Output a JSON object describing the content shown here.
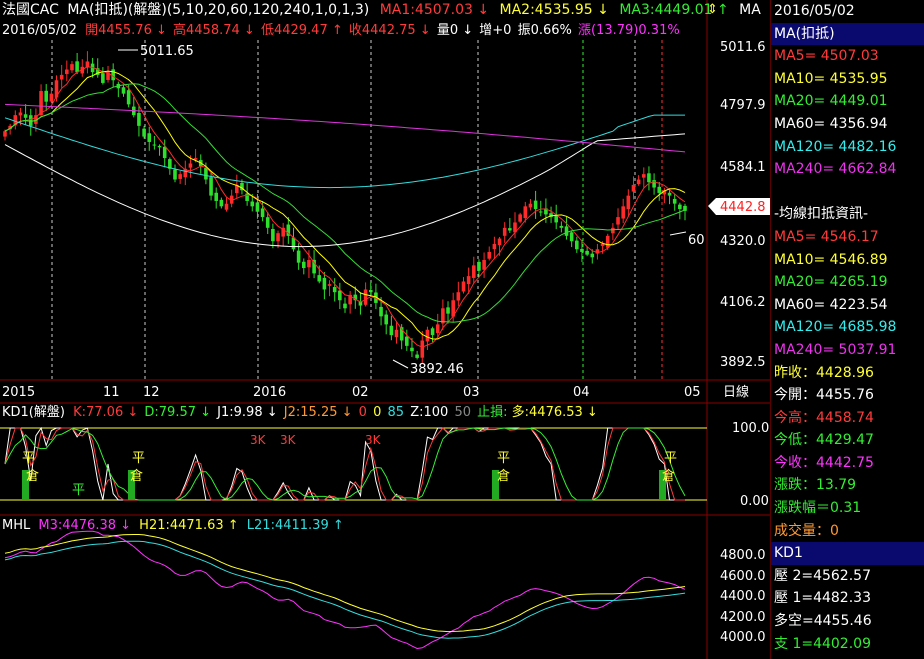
{
  "header": {
    "name": "法國CAC",
    "ma_label": "MA(扣抵)(解盤)(5,10,20,60,120,240,1,0,1,3)",
    "ma1": "MA1:4507.03 ↓",
    "ma2": "MA2:4535.95 ↓",
    "ma3": "MA3:4449.01 ↑",
    "ma_more": "MA",
    "date": "2016/05/02",
    "open": "開4455.76 ↓",
    "high": "高4458.74 ↓",
    "low": "低4429.47 ↑",
    "close": "收4442.75 ↓",
    "vol": "量0 ↓",
    "incr": "增+0",
    "amp": "振0.66%",
    "change": "漲(13.79)0.31%",
    "arrows": "⇕"
  },
  "kd_header": {
    "name": "KD1(解盤)",
    "k": "K:77.06 ↓",
    "d": "D:79.57 ↓",
    "j1": "J1:9.98 ↓",
    "j2": "J2:15.25 ↓",
    "v0": "0",
    "v0b": "0",
    "v85": "85",
    "z": "Z:100",
    "v50": "50",
    "stop": "止損:",
    "long": "多:4476.53 ↓"
  },
  "mhl_header": {
    "name": "MHL",
    "m3": "M3:4476.38 ↓",
    "h21": "H21:4471.63 ↑",
    "l21": "L21:4411.39 ↑"
  },
  "price_axis": [
    "5011.6",
    "4797.9",
    "4584.1",
    "4320.0",
    "4106.2",
    "3892.5"
  ],
  "current_price": "4442.8",
  "kd_axis": [
    "100.00",
    "0.00"
  ],
  "mhl_axis": [
    "4800.0",
    "4600.0",
    "4400.0",
    "4200.0",
    "4000.0"
  ],
  "time_axis": [
    "2015",
    "11",
    "12",
    "2016",
    "02",
    "03",
    "04",
    "05"
  ],
  "time_label": "日線",
  "annotations": {
    "high": "5011.65",
    "low": "3892.46",
    "ma60": "60"
  },
  "kd_markers": {
    "ping": "平",
    "cang": "倉",
    "sk": "3K"
  },
  "colors": {
    "up": "#ff2a2a",
    "down": "#2ce02c",
    "ma5": "#ffffff",
    "ma10": "#ffff00",
    "ma20": "#33dd33",
    "ma60": "#ffffff",
    "ma120": "#33dddd",
    "ma240": "#dd33dd"
  },
  "side_panel": {
    "date": "2016/05/02",
    "ma_title": "MA(扣抵)",
    "ma": [
      {
        "label": "MA5= 4507.03",
        "color": "#ff3b3b"
      },
      {
        "label": "MA10= 4535.95",
        "color": "#ffff33"
      },
      {
        "label": "MA20= 4449.01",
        "color": "#33ee33"
      },
      {
        "label": "MA60= 4356.94",
        "color": "#ffffff"
      },
      {
        "label": "MA120= 4482.16",
        "color": "#33eeee"
      },
      {
        "label": "MA240= 4662.84",
        "color": "#ee33ee"
      }
    ],
    "deduct_title": "-均線扣抵資訊-",
    "deduct": [
      {
        "label": "MA5= 4546.17",
        "color": "#ff3b3b"
      },
      {
        "label": "MA10= 4546.89",
        "color": "#ffff33"
      },
      {
        "label": "MA20= 4265.19",
        "color": "#33ee33"
      },
      {
        "label": "MA60= 4223.54",
        "color": "#ffffff"
      },
      {
        "label": "MA120= 4685.98",
        "color": "#33eeee"
      },
      {
        "label": "MA240= 5037.91",
        "color": "#ee33ee"
      }
    ],
    "quote": [
      {
        "label": "昨收：4428.96",
        "color": "#ffff33"
      },
      {
        "label": "今開：4455.76",
        "color": "#ffffff"
      },
      {
        "label": "今高：4458.74",
        "color": "#ff3b3b"
      },
      {
        "label": "今低：4429.47",
        "color": "#33ee33"
      },
      {
        "label": "今收：4442.75",
        "color": "#ff33ff"
      },
      {
        "label": "漲跌：13.79",
        "color": "#33ee33"
      },
      {
        "label": "漲跌幅＝0.31",
        "color": "#33ee33"
      },
      {
        "label": "成交量：0",
        "color": "#ff9933"
      }
    ],
    "kd_title": "KD1",
    "kd": [
      {
        "label": "壓 2=4562.57",
        "color": "#ffffff"
      },
      {
        "label": "壓 1=4482.33",
        "color": "#ffffff"
      },
      {
        "label": "多空=4455.46",
        "color": "#ffffff"
      },
      {
        "label": "支 1=4402.09",
        "color": "#33ee33"
      }
    ]
  },
  "chart_data": [
    {
      "type": "candlestick",
      "title": "法國CAC",
      "ylim": [
        3850,
        5080
      ],
      "x": [
        "2015-10-20",
        "2015-10-21",
        "2015-10-22",
        "2015-10-23",
        "2015-10-26",
        "2015-10-27",
        "2015-10-28",
        "2015-10-29",
        "2015-10-30",
        "2015-11-02",
        "2015-11-03",
        "2015-11-04",
        "2015-11-05",
        "2015-11-06",
        "2015-11-09",
        "2015-11-10",
        "2015-11-11",
        "2015-11-12",
        "2015-11-13",
        "2015-11-16",
        "2015-11-17",
        "2015-11-18",
        "2015-11-19",
        "2015-11-20",
        "2015-11-23",
        "2015-11-24",
        "2015-11-25",
        "2015-11-26",
        "2015-11-27",
        "2015-11-30",
        "2015-12-01",
        "2015-12-02",
        "2015-12-03",
        "2015-12-04",
        "2015-12-07",
        "2015-12-08",
        "2015-12-09",
        "2015-12-10",
        "2015-12-11",
        "2015-12-14",
        "2015-12-15",
        "2015-12-16",
        "2015-12-17",
        "2015-12-18",
        "2015-12-21",
        "2015-12-22",
        "2015-12-23",
        "2015-12-24",
        "2015-12-28",
        "2015-12-29",
        "2015-12-30",
        "2015-12-31",
        "2016-01-04",
        "2016-01-05",
        "2016-01-06",
        "2016-01-07",
        "2016-01-08",
        "2016-01-11",
        "2016-01-12",
        "2016-01-13",
        "2016-01-14",
        "2016-01-15",
        "2016-01-18",
        "2016-01-19",
        "2016-01-20",
        "2016-01-21",
        "2016-01-22",
        "2016-01-25",
        "2016-01-26",
        "2016-01-27",
        "2016-01-28",
        "2016-01-29",
        "2016-02-01",
        "2016-02-02",
        "2016-02-03",
        "2016-02-04",
        "2016-02-05",
        "2016-02-08",
        "2016-02-09",
        "2016-02-10",
        "2016-02-11",
        "2016-02-12",
        "2016-02-15",
        "2016-02-16",
        "2016-02-17",
        "2016-02-18",
        "2016-02-19",
        "2016-02-22",
        "2016-02-23",
        "2016-02-24",
        "2016-02-25",
        "2016-02-26",
        "2016-02-29",
        "2016-03-01",
        "2016-03-02",
        "2016-03-03",
        "2016-03-04",
        "2016-03-07",
        "2016-03-08",
        "2016-03-09",
        "2016-03-10",
        "2016-03-11",
        "2016-03-14",
        "2016-03-15",
        "2016-03-16",
        "2016-03-17",
        "2016-03-18",
        "2016-03-21",
        "2016-03-22",
        "2016-03-23",
        "2016-03-24",
        "2016-03-29",
        "2016-03-30",
        "2016-03-31",
        "2016-04-01",
        "2016-04-04",
        "2016-04-05",
        "2016-04-06",
        "2016-04-07",
        "2016-04-08",
        "2016-04-11",
        "2016-04-12",
        "2016-04-13",
        "2016-04-14",
        "2016-04-15",
        "2016-04-18",
        "2016-04-19",
        "2016-04-20",
        "2016-04-21",
        "2016-04-22",
        "2016-04-25",
        "2016-04-26",
        "2016-04-27",
        "2016-04-28",
        "2016-04-29",
        "2016-05-02"
      ],
      "close": [
        4740,
        4760,
        4800,
        4810,
        4790,
        4760,
        4800,
        4890,
        4850,
        4880,
        4930,
        4950,
        4970,
        4990,
        4960,
        4980,
        5000,
        4960,
        4950,
        4920,
        4960,
        4930,
        4900,
        4880,
        4840,
        4800,
        4760,
        4720,
        4700,
        4690,
        4680,
        4640,
        4600,
        4560,
        4580,
        4600,
        4620,
        4640,
        4610,
        4560,
        4500,
        4480,
        4460,
        4470,
        4500,
        4540,
        4520,
        4480,
        4460,
        4440,
        4420,
        4380,
        4330,
        4360,
        4380,
        4350,
        4300,
        4250,
        4230,
        4260,
        4210,
        4180,
        4150,
        4170,
        4140,
        4110,
        4080,
        4130,
        4110,
        4090,
        4150,
        4140,
        4100,
        4050,
        4020,
        3980,
        4000,
        3960,
        3940,
        3920,
        3895,
        3960,
        4000,
        3980,
        4020,
        4080,
        4060,
        4110,
        4140,
        4180,
        4200,
        4240,
        4220,
        4260,
        4290,
        4320,
        4340,
        4380,
        4370,
        4400,
        4430,
        4460,
        4470,
        4450,
        4440,
        4430,
        4420,
        4400,
        4380,
        4350,
        4330,
        4300,
        4290,
        4280,
        4270,
        4300,
        4320,
        4350,
        4380,
        4420,
        4460,
        4500,
        4540,
        4560,
        4580,
        4550,
        4530,
        4510,
        4520,
        4500,
        4470,
        4450,
        4443
      ],
      "values_note": "estimated"
    },
    {
      "type": "line",
      "title": "KD1(解盤)",
      "ylim": [
        0,
        100
      ],
      "series": [
        {
          "name": "K",
          "last": 77.06
        },
        {
          "name": "D",
          "last": 79.57
        }
      ]
    },
    {
      "type": "line",
      "title": "MHL",
      "ylim": [
        3950,
        4900
      ],
      "series": [
        {
          "name": "M3",
          "last": 4476.38
        },
        {
          "name": "H21",
          "last": 4471.63
        },
        {
          "name": "L21",
          "last": 4411.39
        }
      ]
    }
  ]
}
